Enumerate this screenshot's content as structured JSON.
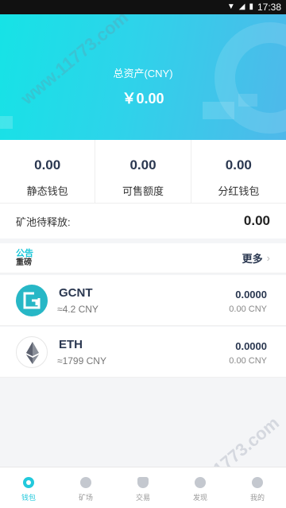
{
  "status_bar": {
    "time": "17:38"
  },
  "header": {
    "total_label": "总资产(CNY)",
    "total_value": "￥0.00"
  },
  "stats": [
    {
      "value": "0.00",
      "label": "静态钱包"
    },
    {
      "value": "0.00",
      "label": "可售额度"
    },
    {
      "value": "0.00",
      "label": "分红钱包"
    }
  ],
  "pool": {
    "label": "矿池待释放:",
    "value": "0.00"
  },
  "notice": {
    "tag_top": "公告",
    "tag_bottom": "重磅",
    "more_label": "更多"
  },
  "coins": [
    {
      "name": "GCNT",
      "approx": "≈4.2 CNY",
      "amount": "0.0000",
      "cny": "0.00 CNY"
    },
    {
      "name": "ETH",
      "approx": "≈1799 CNY",
      "amount": "0.0000",
      "cny": "0.00 CNY"
    }
  ],
  "tabs": [
    {
      "label": "钱包",
      "icon": "wallet-icon"
    },
    {
      "label": "矿场",
      "icon": "mine-icon"
    },
    {
      "label": "交易",
      "icon": "trade-icon"
    },
    {
      "label": "发现",
      "icon": "discover-icon"
    },
    {
      "label": "我的",
      "icon": "profile-icon"
    }
  ],
  "watermark": "www.11773.com",
  "colors": {
    "accent": "#22c9dc",
    "header_start": "#16e3e6",
    "header_end": "#4fb8ea",
    "text_dark": "#2a3750"
  }
}
